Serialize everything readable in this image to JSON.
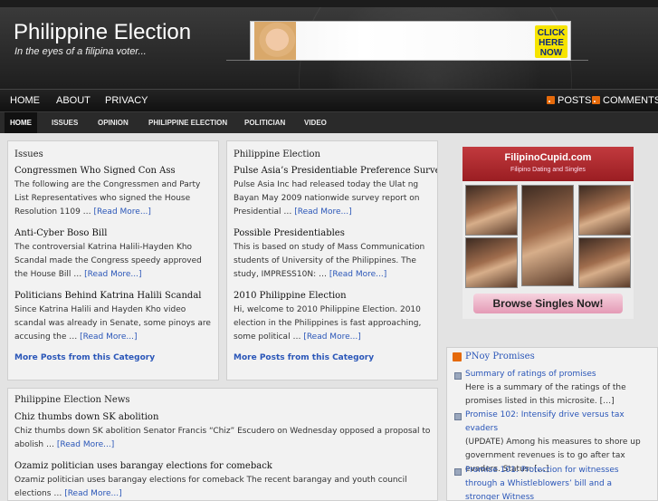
{
  "site": {
    "title": "Philippine Election",
    "tagline": "In the eyes of a filipina voter..."
  },
  "banner_ad": {
    "cta_lines": [
      "CLICK",
      "HERE",
      "NOW"
    ]
  },
  "nav_primary": {
    "items": [
      "HOME",
      "ABOUT",
      "PRIVACY"
    ],
    "posts_label": "POSTS",
    "comments_label": "COMMENTS"
  },
  "nav_secondary": {
    "items": [
      "HOME",
      "ISSUES",
      "OPINION",
      "PHILIPPINE ELECTION",
      "POLITICIAN",
      "VIDEO"
    ]
  },
  "read_more": "[Read More...]",
  "ellipsis": " … ",
  "issues": {
    "title": "Issues",
    "more": "More Posts from this Category",
    "posts": [
      {
        "title": "Congressmen Who Signed Con Ass",
        "excerpt": "The following are the Congressmen and Party List Representatives who signed the House Resolution 1109"
      },
      {
        "title": "Anti-Cyber Boso Bill",
        "excerpt": "The controversial Katrina Halili-Hayden Kho Scandal made the Congress speedy approved the House Bill"
      },
      {
        "title": "Politicians Behind Katrina Halili Scandal",
        "excerpt": "Since Katrina Halili and Hayden Kho video scandal was already in Senate, some pinoys are accusing the"
      }
    ]
  },
  "philippine_election": {
    "title": "Philippine Election",
    "more": "More Posts from this Category",
    "posts": [
      {
        "title": "Pulse Asia’s Presidentiable Preference Survey",
        "excerpt": "Pulse Asia Inc had released today the Ulat ng Bayan May 2009 nationwide survey report on Presidential"
      },
      {
        "title": "Possible Presidentiables",
        "excerpt": "This is based on study of Mass Communication students of University of the Philippines. The study, IMPRESS10N:"
      },
      {
        "title": "2010 Philippine Election",
        "excerpt": "Hi, welcome to 2010 Philippine Election. 2010 election in the Philippines is fast approaching, some political"
      }
    ]
  },
  "news": {
    "title": "Philippine Election News",
    "posts": [
      {
        "title": "Chiz thumbs down SK abolition",
        "excerpt": "Chiz thumbs down SK abolition Senator Francis “Chiz” Escudero on Wednesday opposed a proposal to abolish"
      },
      {
        "title": "Ozamiz politician uses barangay elections for comeback",
        "excerpt": "Ozamiz politician uses barangay elections for comeback The recent barangay and youth council elections"
      }
    ]
  },
  "sidebar_ad": {
    "brand": "FilipinoCupid.com",
    "subtitle": "Filipino Dating and Singles",
    "button": "Browse Singles Now!"
  },
  "pnoy": {
    "title": "PNoy Promises",
    "items": [
      {
        "link": "Summary of ratings of promises",
        "text": "Here is a summary of the ratings of the promises listed in this microsite. […]"
      },
      {
        "link": "Promise 102: Intensify drive versus tax evaders",
        "text": "(UPDATE) Among his measures to shore up government revenues is to go after tax evaders. Status: […]"
      },
      {
        "link": "Promise 101: Protection for witnesses through a Whistleblowers’ bill and a stronger Witness",
        "text": ""
      }
    ]
  },
  "colors": {
    "link": "#2a56b8",
    "rss": "#e56a0b",
    "header_bg": "#2e2e2e",
    "ad_red": "#b2292e"
  }
}
